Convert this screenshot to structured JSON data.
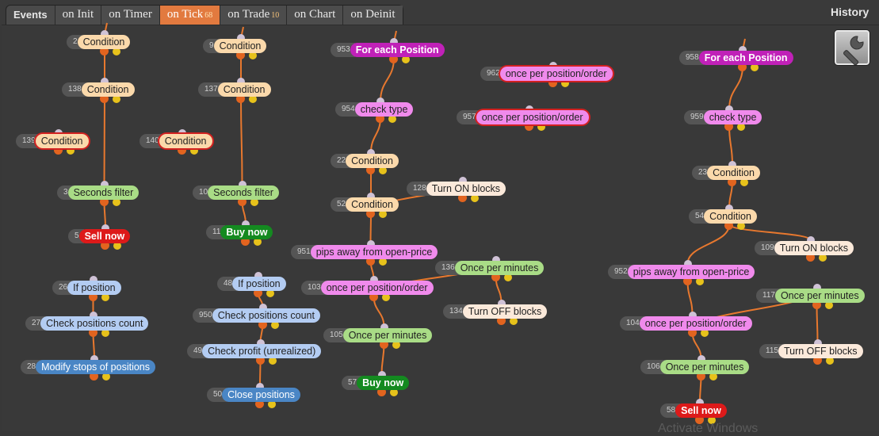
{
  "header": {
    "events_label": "Events",
    "tabs": [
      {
        "label": "on Init",
        "count": ""
      },
      {
        "label": "on Timer",
        "count": ""
      },
      {
        "label": "on Tick",
        "count": "68"
      },
      {
        "label": "on Trade",
        "count": "10"
      },
      {
        "label": "on Chart",
        "count": ""
      },
      {
        "label": "on Deinit",
        "count": ""
      }
    ],
    "active_tab": "on Tick",
    "history_label": "History"
  },
  "colors": {
    "condition": "#fbd9ab",
    "filter": "#a9dc86",
    "position": "#b3ccf2",
    "pink": "#f08aec",
    "for_each": "#c021b8",
    "block_control": "#fbe9da",
    "sell": "#dd1a1a",
    "buy": "#148a20",
    "wire": "#e8782e",
    "error_outline": "#d12020"
  },
  "tool_icon": "wrench-icon",
  "nodes": [
    {
      "id": "2",
      "label": "Condition",
      "style": "cond"
    },
    {
      "id": "138",
      "label": "Condition",
      "style": "cond"
    },
    {
      "id": "139",
      "label": "Condition",
      "style": "cond",
      "error": true
    },
    {
      "id": "140",
      "label": "Condition",
      "style": "cond",
      "error": true
    },
    {
      "id": "3",
      "label": "Seconds filter",
      "style": "green"
    },
    {
      "id": "5",
      "label": "Sell now",
      "style": "sell"
    },
    {
      "id": "9",
      "label": "Condition",
      "style": "cond"
    },
    {
      "id": "137",
      "label": "Condition",
      "style": "cond"
    },
    {
      "id": "10",
      "label": "Seconds filter",
      "style": "green"
    },
    {
      "id": "11",
      "label": "Buy now",
      "style": "buy"
    },
    {
      "id": "26",
      "label": "If position",
      "style": "blue"
    },
    {
      "id": "27",
      "label": "Check positions count",
      "style": "blue"
    },
    {
      "id": "28",
      "label": "Modify stops of positions",
      "style": "dblue"
    },
    {
      "id": "48",
      "label": "If position",
      "style": "blue"
    },
    {
      "id": "950",
      "label": "Check positions count",
      "style": "blue"
    },
    {
      "id": "49",
      "label": "Check profit (unrealized)",
      "style": "blue"
    },
    {
      "id": "50",
      "label": "Close positions",
      "style": "dblue"
    },
    {
      "id": "953",
      "label": "For each Position",
      "style": "purple"
    },
    {
      "id": "954",
      "label": "check type",
      "style": "pink"
    },
    {
      "id": "22",
      "label": "Condition",
      "style": "cond"
    },
    {
      "id": "52",
      "label": "Condition",
      "style": "cond"
    },
    {
      "id": "128",
      "label": "Turn ON blocks",
      "style": "cream"
    },
    {
      "id": "951",
      "label": "pips away from open-price",
      "style": "pink"
    },
    {
      "id": "103",
      "label": "once per position/order",
      "style": "pink"
    },
    {
      "id": "136",
      "label": "Once per minutes",
      "style": "green"
    },
    {
      "id": "134",
      "label": "Turn OFF blocks",
      "style": "cream"
    },
    {
      "id": "105",
      "label": "Once per minutes",
      "style": "green"
    },
    {
      "id": "57",
      "label": "Buy now",
      "style": "buy"
    },
    {
      "id": "962",
      "label": "once per position/order",
      "style": "pink",
      "error": true
    },
    {
      "id": "957",
      "label": "once per position/order",
      "style": "pink",
      "error": true
    },
    {
      "id": "958",
      "label": "For each Position",
      "style": "purple"
    },
    {
      "id": "959",
      "label": "check type",
      "style": "pink"
    },
    {
      "id": "23",
      "label": "Condition",
      "style": "cond"
    },
    {
      "id": "54",
      "label": "Condition",
      "style": "cond"
    },
    {
      "id": "109",
      "label": "Turn ON blocks",
      "style": "cream"
    },
    {
      "id": "952",
      "label": "pips away from open-price",
      "style": "pink"
    },
    {
      "id": "104",
      "label": "once per position/order",
      "style": "pink"
    },
    {
      "id": "117",
      "label": "Once per minutes",
      "style": "green"
    },
    {
      "id": "115",
      "label": "Turn OFF blocks",
      "style": "cream"
    },
    {
      "id": "106",
      "label": "Once per minutes",
      "style": "green"
    },
    {
      "id": "58",
      "label": "Sell now",
      "style": "sell"
    }
  ],
  "connections": [
    [
      "2",
      "138"
    ],
    [
      "138",
      "3"
    ],
    [
      "3",
      "5"
    ],
    [
      "9",
      "137"
    ],
    [
      "137",
      "10"
    ],
    [
      "10",
      "11"
    ],
    [
      "26",
      "27"
    ],
    [
      "27",
      "28"
    ],
    [
      "48",
      "950"
    ],
    [
      "950",
      "49"
    ],
    [
      "49",
      "50"
    ],
    [
      "953",
      "954"
    ],
    [
      "954",
      "22"
    ],
    [
      "22",
      "52"
    ],
    [
      "52",
      "128"
    ],
    [
      "52",
      "951"
    ],
    [
      "951",
      "103"
    ],
    [
      "103",
      "136"
    ],
    [
      "136",
      "134"
    ],
    [
      "103",
      "105"
    ],
    [
      "105",
      "57"
    ],
    [
      "958",
      "959"
    ],
    [
      "959",
      "23"
    ],
    [
      "23",
      "54"
    ],
    [
      "54",
      "109"
    ],
    [
      "54",
      "952"
    ],
    [
      "952",
      "104"
    ],
    [
      "104",
      "117"
    ],
    [
      "117",
      "115"
    ],
    [
      "104",
      "106"
    ],
    [
      "106",
      "58"
    ]
  ]
}
